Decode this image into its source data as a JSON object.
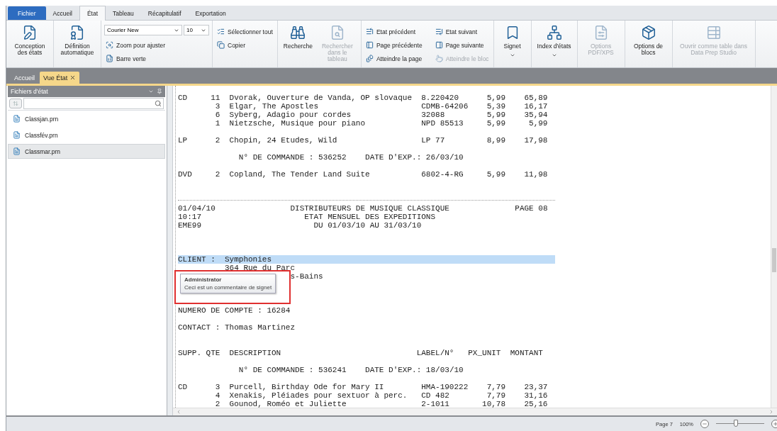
{
  "menu_tabs": [
    {
      "label": "Fichier",
      "kind": "file",
      "selected": false
    },
    {
      "label": "Accueil",
      "kind": "tab",
      "selected": false
    },
    {
      "label": "État",
      "kind": "tab",
      "selected": true
    },
    {
      "label": "Tableau",
      "kind": "tab",
      "selected": false
    },
    {
      "label": "Récapitulatif",
      "kind": "tab",
      "selected": false
    },
    {
      "label": "Exportation",
      "kind": "tab",
      "selected": false
    }
  ],
  "ribbon": {
    "groups": [
      {
        "items": [
          {
            "kind": "large",
            "label": "Conception des états",
            "disabled": false,
            "dropdown": false
          }
        ]
      },
      {
        "items": [
          {
            "kind": "large",
            "label": "Définition automatique",
            "disabled": false,
            "dropdown": false
          }
        ]
      },
      {
        "items": [
          {
            "kind": "select",
            "font": "Courier New",
            "size": "10"
          },
          {
            "kind": "small",
            "label": "Zoom pour ajuster",
            "disabled": false
          },
          {
            "kind": "small",
            "label": "Barre verte",
            "disabled": false
          }
        ]
      },
      {
        "items": [
          {
            "kind": "small",
            "label": "Sélectionner tout",
            "disabled": false
          },
          {
            "kind": "small",
            "label": "Copier",
            "disabled": false
          }
        ]
      },
      {
        "items": [
          {
            "kind": "large",
            "label": "Recherche",
            "disabled": false,
            "dropdown": false
          },
          {
            "kind": "large",
            "label": "Rechercher dans le tableau",
            "disabled": true,
            "dropdown": false
          }
        ]
      },
      {
        "items": [
          {
            "kind": "small",
            "label": "Etat précédent",
            "disabled": false
          },
          {
            "kind": "small",
            "label": "Page précédente",
            "disabled": false
          },
          {
            "kind": "small",
            "label": "Atteindre la page",
            "disabled": false
          },
          {
            "kind": "small",
            "label": "Etat suivant",
            "disabled": false
          },
          {
            "kind": "small",
            "label": "Page suivante",
            "disabled": false
          },
          {
            "kind": "small",
            "label": "Atteindre le bloc",
            "disabled": true
          }
        ]
      },
      {
        "items": [
          {
            "kind": "large",
            "label": "Signet",
            "disabled": false,
            "dropdown": true
          }
        ]
      },
      {
        "items": [
          {
            "kind": "large",
            "label": "Index d'états",
            "disabled": false,
            "dropdown": true
          }
        ]
      },
      {
        "items": [
          {
            "kind": "large",
            "label": "Options PDF/XPS",
            "disabled": true,
            "dropdown": false
          }
        ]
      },
      {
        "items": [
          {
            "kind": "large",
            "label": "Options de blocs",
            "disabled": false,
            "dropdown": false
          }
        ]
      },
      {
        "items": [
          {
            "kind": "large",
            "label": "Ouvrir comme table dans Data Prep Studio",
            "disabled": true,
            "dropdown": false
          }
        ]
      }
    ]
  },
  "doc_tabs": [
    {
      "label": "Accueil",
      "selected": false,
      "closable": false
    },
    {
      "label": "Vue État",
      "selected": true,
      "closable": true
    }
  ],
  "sidebar": {
    "title": "Fichiers d'état",
    "files": [
      {
        "name": "Classjan.prn",
        "selected": false
      },
      {
        "name": "Classfév.prn",
        "selected": false
      },
      {
        "name": "Classmar.prn",
        "selected": true
      }
    ]
  },
  "report": {
    "lines": [
      {
        "kind": "item",
        "supp": "CD",
        "qty": "11",
        "description": "Dvorak, Ouverture de Vanda, OP slovaque",
        "label": "8.220420",
        "price": "5,99",
        "amount": "65,89"
      },
      {
        "kind": "item",
        "qty": "3",
        "description": "Elgar, The Apostles",
        "label": "CDMB-64206",
        "price": "5,39",
        "amount": "16,17"
      },
      {
        "kind": "item",
        "qty": "6",
        "description": "Syberg, Adagio pour cordes",
        "label": "32088",
        "price": "5,99",
        "amount": "35,94"
      },
      {
        "kind": "item",
        "qty": "1",
        "description": "Nietzsche, Musique pour piano",
        "label": "NPD 85513",
        "price": "5,99",
        "amount": "5,99"
      },
      {
        "kind": "blank"
      },
      {
        "kind": "item",
        "supp": "LP",
        "qty": "2",
        "description": "Chopin, 24 Etudes, Wild",
        "label": "LP 77",
        "price": "8,99",
        "amount": "17,98"
      },
      {
        "kind": "blank"
      },
      {
        "kind": "text",
        "text": "             N° DE COMMANDE : 536252    DATE D'EXP.: 26/03/10"
      },
      {
        "kind": "blank"
      },
      {
        "kind": "item",
        "supp": "DVD",
        "qty": "2",
        "description": "Copland, The Tender Land Suite",
        "label": "6802-4-RG",
        "price": "5,99",
        "amount": "11,98"
      },
      {
        "kind": "blank"
      },
      {
        "kind": "blank"
      },
      {
        "kind": "page-break"
      },
      {
        "kind": "text",
        "text": "01/04/10                DISTRIBUTEURS DE MUSIQUE CLASSIQUE              PAGE 08"
      },
      {
        "kind": "text",
        "text": "10:17                      ETAT MENSUEL DES EXPEDITIONS"
      },
      {
        "kind": "text",
        "text": "EME99                        DU 01/03/10 AU 31/03/10"
      },
      {
        "kind": "blank"
      },
      {
        "kind": "blank"
      },
      {
        "kind": "blank"
      },
      {
        "kind": "bookmark",
        "text": "CLIENT :  Symphonies"
      },
      {
        "kind": "text",
        "text": "          364 Rue du Parc"
      },
      {
        "kind": "text",
        "text": "                        s-Bains"
      },
      {
        "kind": "blank"
      },
      {
        "kind": "blank"
      },
      {
        "kind": "blank"
      },
      {
        "kind": "text",
        "text": "NUMERO DE COMPTE : 16284"
      },
      {
        "kind": "blank"
      },
      {
        "kind": "text",
        "text": "CONTACT : Thomas Martinez"
      },
      {
        "kind": "blank"
      },
      {
        "kind": "blank"
      },
      {
        "kind": "text",
        "text": "SUPP. QTE  DESCRIPTION                             LABEL/N°   PX_UNIT  MONTANT"
      },
      {
        "kind": "blank"
      },
      {
        "kind": "text",
        "text": "             N° DE COMMANDE : 536241    DATE D'EXP.: 18/03/10"
      },
      {
        "kind": "blank"
      },
      {
        "kind": "item",
        "supp": "CD",
        "qty": "3",
        "description": "Purcell, Birthday Ode for Mary II",
        "label": "HMA-190222",
        "price": "7,79",
        "amount": "23,37"
      },
      {
        "kind": "item",
        "qty": "4",
        "description": "Xenakis, Pléiades pour sextuor à perc.",
        "label": "CD 482",
        "price": "7,79",
        "amount": "31,16"
      },
      {
        "kind": "item",
        "qty": "2",
        "description": "Gounod, Roméo et Juliette",
        "label": "2-1011",
        "price": "10,78",
        "amount": "25,16"
      }
    ]
  },
  "tooltip": {
    "author": "Administrator",
    "comment": "Ceci est un commentaire de signet"
  },
  "status_bar": {
    "page": "Page 7",
    "zoom": "100%",
    "zoom_slider": {
      "level": 0.42
    }
  }
}
